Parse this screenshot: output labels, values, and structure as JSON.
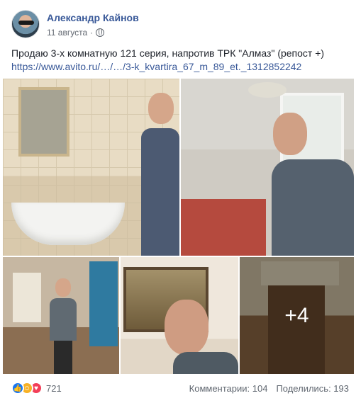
{
  "post": {
    "author": "Александр Кайнов",
    "date": "11 августа",
    "text": "Продаю 3-х комнатную 121 серия, напротив ТРК \"Алмаз\" (репост +)",
    "link": "https://www.avito.ru/…/…/3-k_kvartira_67_m_89_et._1312852242",
    "more_photos": "+4"
  },
  "footer": {
    "reactions_count": "721",
    "comments": "Комментарии: 104",
    "shares": "Поделились: 193"
  },
  "icons": {
    "privacy": "globe-icon",
    "reactions": [
      "like-icon",
      "haha-icon",
      "love-icon"
    ]
  },
  "colors": {
    "link": "#385898",
    "meta": "#616770",
    "like": "#1877f2",
    "haha": "#f7b125",
    "love": "#f33e58"
  }
}
